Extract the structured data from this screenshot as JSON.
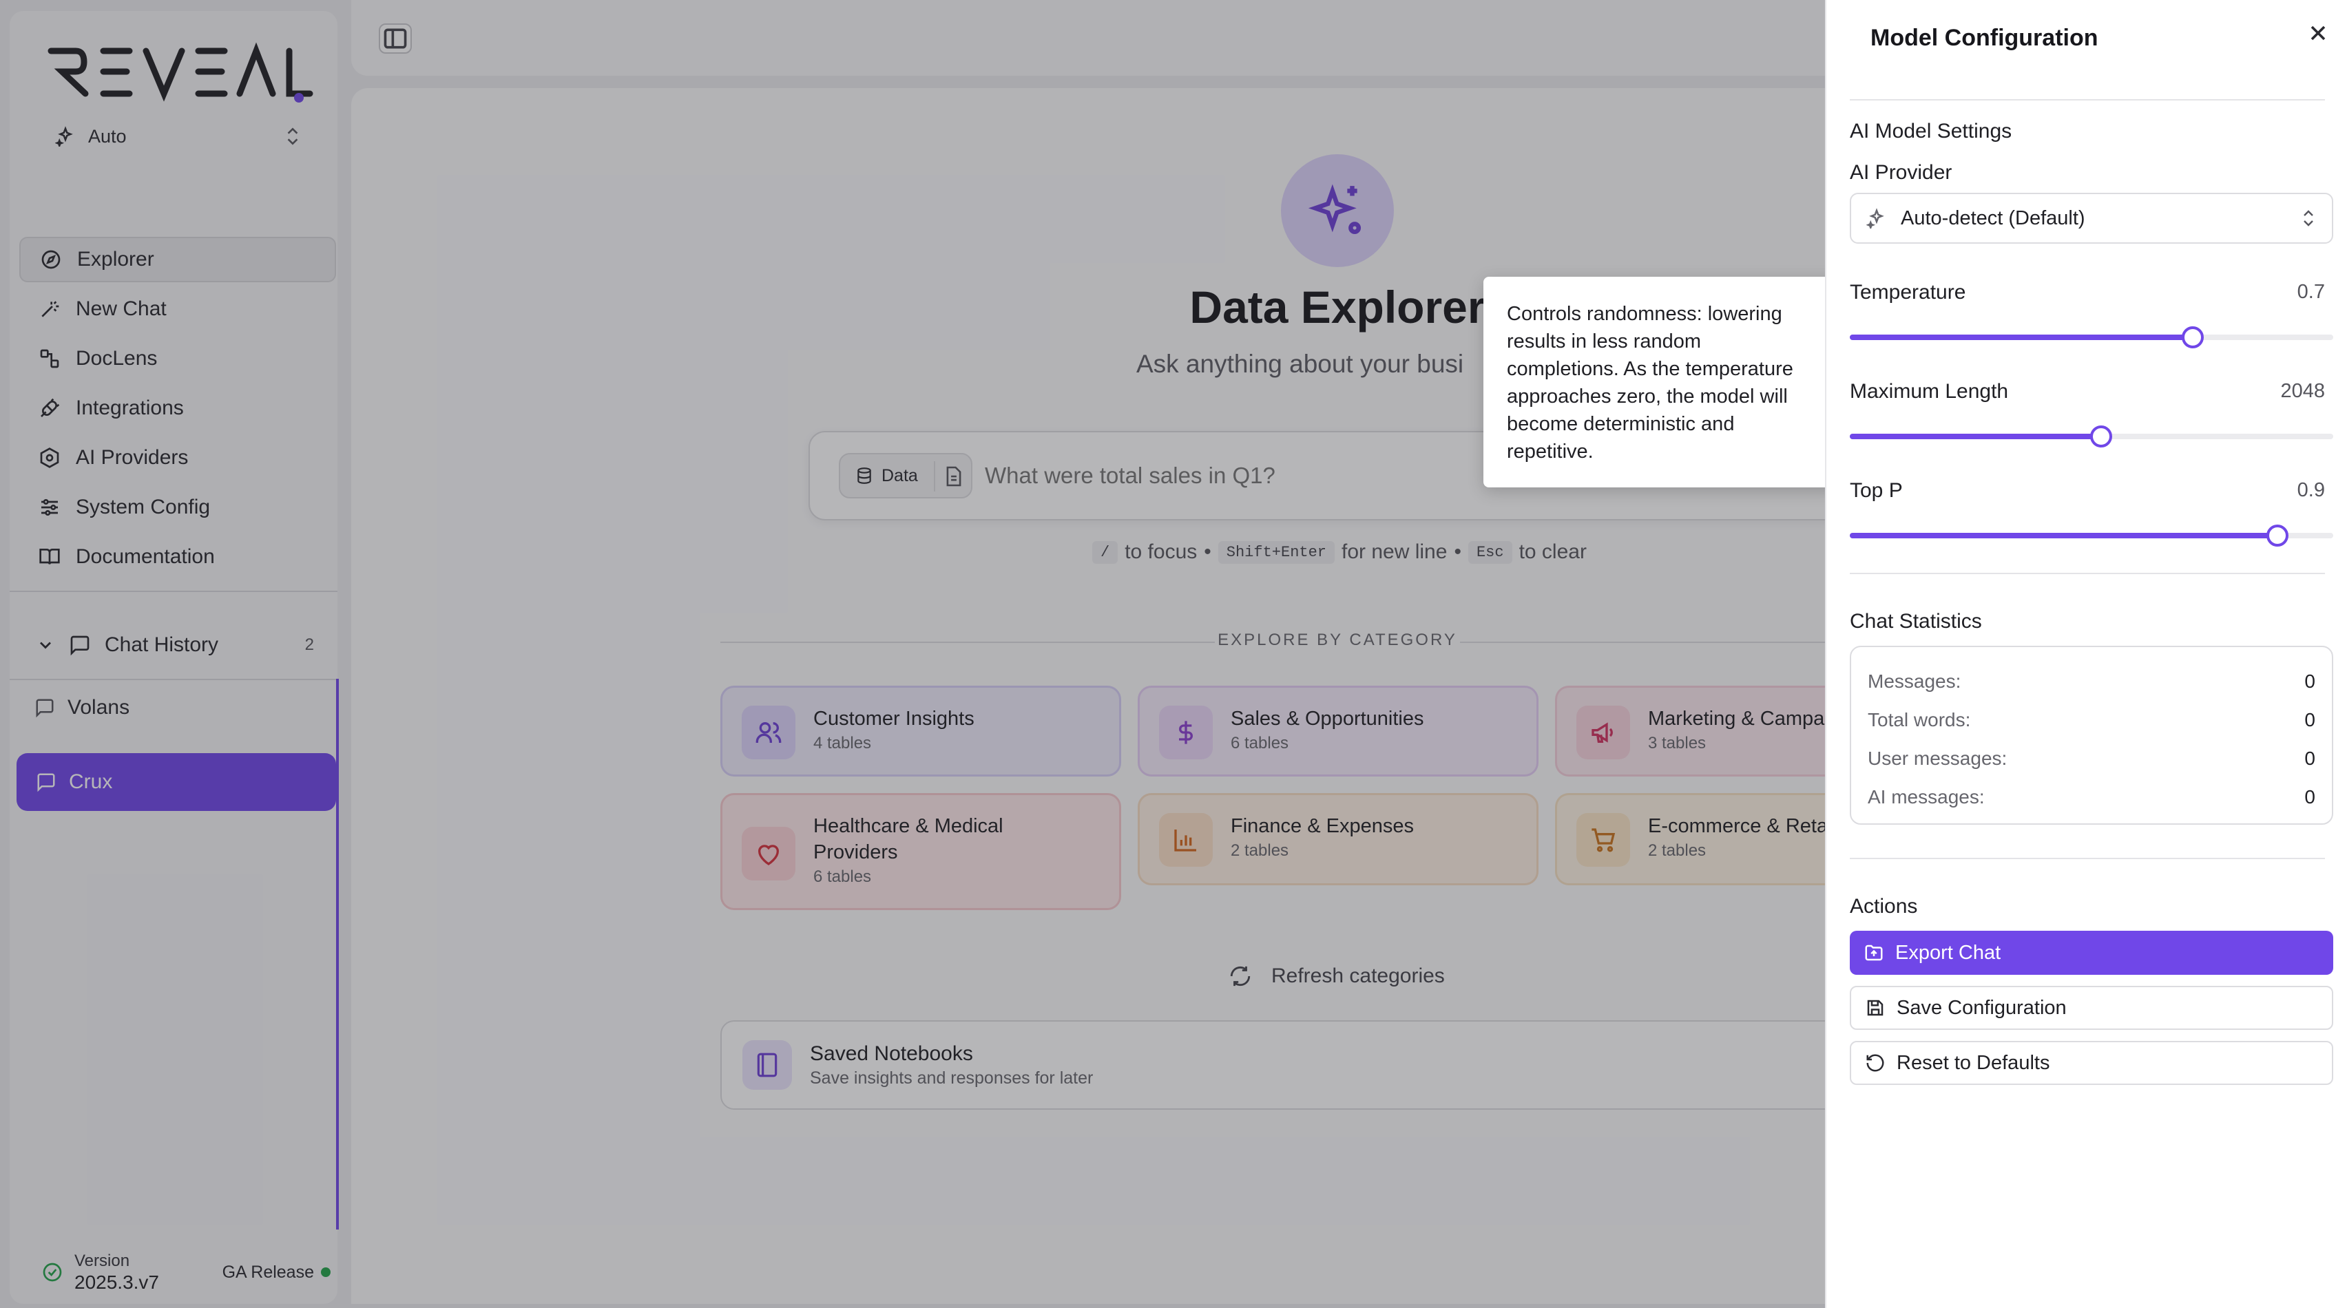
{
  "colors": {
    "accent": "#7047e8",
    "overlay": "rgba(40,40,48,0.34)",
    "status_ok": "#22a34a"
  },
  "sidebar": {
    "logo_text": "REVEAL",
    "model_select": {
      "label": "Auto",
      "icon": "sparkles-icon"
    },
    "nav": [
      {
        "label": "Explorer",
        "icon": "compass-icon",
        "active": true
      },
      {
        "label": "New Chat",
        "icon": "magic-wand-icon"
      },
      {
        "label": "DocLens",
        "icon": "doclens-icon"
      },
      {
        "label": "Integrations",
        "icon": "plug-icon"
      },
      {
        "label": "AI Providers",
        "icon": "hexagon-icon"
      },
      {
        "label": "System Config",
        "icon": "sliders-icon"
      },
      {
        "label": "Documentation",
        "icon": "book-icon"
      }
    ],
    "chat_history": {
      "label": "Chat History",
      "count": "2"
    },
    "chats": [
      {
        "label": "Volans",
        "active": false
      },
      {
        "label": "Crux",
        "active": true
      }
    ],
    "version": {
      "label": "Version",
      "number": "2025.3.v7",
      "release": "GA Release"
    }
  },
  "main": {
    "title": "Data Explorer",
    "subtitle": "Ask anything about your busi",
    "search": {
      "chip_label": "Data",
      "placeholder": "What were total sales in Q1?"
    },
    "hints": [
      {
        "key": "/",
        "text": "to focus"
      },
      {
        "key": "Shift+Enter",
        "text": "for new line"
      },
      {
        "key": "Esc",
        "text": "to clear"
      }
    ],
    "explore_label": "EXPLORE BY CATEGORY",
    "categories": [
      {
        "title": "Customer Insights",
        "subtitle": "4 tables",
        "icon": "users-icon"
      },
      {
        "title": "Sales & Opportunities",
        "subtitle": "6 tables",
        "icon": "dollar-icon"
      },
      {
        "title": "Marketing & Campa",
        "subtitle": "3 tables",
        "icon": "megaphone-icon"
      },
      {
        "title": "Healthcare & Medical Providers",
        "subtitle": "6 tables",
        "icon": "heart-icon"
      },
      {
        "title": "Finance & Expenses",
        "subtitle": "2 tables",
        "icon": "bar-chart-icon"
      },
      {
        "title": "E-commerce & Reta",
        "subtitle": "2 tables",
        "icon": "cart-icon"
      }
    ],
    "refresh_label": "Refresh categories",
    "saved_notebooks": {
      "title": "Saved Notebooks",
      "subtitle": "Save insights and responses for later"
    }
  },
  "tooltip": {
    "text": "Controls randomness: lowering results in less random completions. As the temperature approaches zero, the model will become deterministic and repetitive."
  },
  "panel": {
    "title": "Model Configuration",
    "ai_settings_label": "AI Model Settings",
    "provider_label": "AI Provider",
    "provider_value": "Auto-detect (Default)",
    "temperature": {
      "label": "Temperature",
      "value": "0.7",
      "fraction": 0.71
    },
    "max_length": {
      "label": "Maximum Length",
      "value": "2048",
      "fraction": 0.52
    },
    "top_p": {
      "label": "Top P",
      "value": "0.9",
      "fraction": 0.885
    },
    "chat_stats_label": "Chat Statistics",
    "stats": [
      {
        "label": "Messages:",
        "value": "0"
      },
      {
        "label": "Total words:",
        "value": "0"
      },
      {
        "label": "User messages:",
        "value": "0"
      },
      {
        "label": "AI messages:",
        "value": "0"
      }
    ],
    "actions_label": "Actions",
    "actions": {
      "export": "Export Chat",
      "save": "Save Configuration",
      "reset": "Reset to Defaults"
    }
  }
}
